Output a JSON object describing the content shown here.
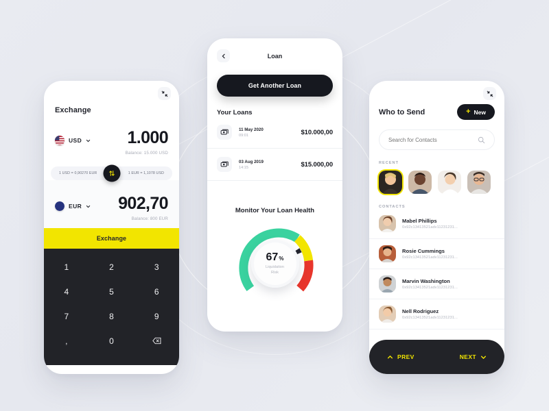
{
  "background": {
    "color": "#e8eaf0",
    "accent_yellow": "#f2e500",
    "dark": "#16181f"
  },
  "exchange": {
    "collapse_icon": "collapse-icon",
    "title": "Exchange",
    "from": {
      "flag": "us-flag-icon",
      "code": "USD",
      "amount": "1.000",
      "balance": "Balance: 15.000 USD"
    },
    "to": {
      "flag": "eu-flag-icon",
      "code": "EUR",
      "amount": "902,70",
      "balance": "Balance: 800 EUR"
    },
    "rate_left": "1 USD = 0,90270 EUR",
    "rate_right": "1 EUR = 1,1078 USD",
    "swap_icon": "swap-arrows-icon",
    "exchange_button": "Exchange",
    "keypad": [
      "1",
      "2",
      "3",
      "4",
      "5",
      "6",
      "7",
      "8",
      "9",
      ",",
      "0",
      "backspace-icon"
    ]
  },
  "loan": {
    "back_icon": "chevron-left-icon",
    "title": "Loan",
    "cta": "Get Another Loan",
    "section_title": "Your Loans",
    "items": [
      {
        "icon": "money-icon",
        "date": "11 May 2020",
        "time": "09:01",
        "amount": "$10.000,00"
      },
      {
        "icon": "money-icon",
        "date": "03 Aug 2019",
        "time": "14:15",
        "amount": "$15.000,00"
      }
    ],
    "health_title": "Monitor Your Loan Health",
    "gauge": {
      "percent": "67",
      "percent_symbol": "%",
      "label_line1": "Liquidation",
      "label_line2": "Risk",
      "green": "#3ad29f",
      "yellow": "#f2e500",
      "red": "#e8362c",
      "needle_value": 67
    }
  },
  "send": {
    "collapse_icon": "collapse-icon",
    "title": "Who to Send",
    "new_button": {
      "plus": "+",
      "label": "New"
    },
    "search": {
      "placeholder": "Search for Contacts",
      "icon": "search-icon"
    },
    "recent_label": "RECENT",
    "recent": [
      {
        "name": "recent-avatar-1",
        "active": true
      },
      {
        "name": "recent-avatar-2",
        "active": false
      },
      {
        "name": "recent-avatar-3",
        "active": false
      },
      {
        "name": "recent-avatar-4",
        "active": false
      }
    ],
    "contacts_label": "CONTACTS",
    "contacts": [
      {
        "name": "Mabel Phillips",
        "address": "0x92c13413521adv11231231..."
      },
      {
        "name": "Rosie Cummings",
        "address": "0x92c13413521adv11231231..."
      },
      {
        "name": "Marvin Washington",
        "address": "0x92c13413521adv11231231..."
      },
      {
        "name": "Nell Rodriguez",
        "address": "0x92c13413521adv11231231..."
      }
    ],
    "pager": {
      "prev": "PREV",
      "next": "NEXT",
      "prev_icon": "chevron-up-icon",
      "next_icon": "chevron-down-icon"
    }
  }
}
